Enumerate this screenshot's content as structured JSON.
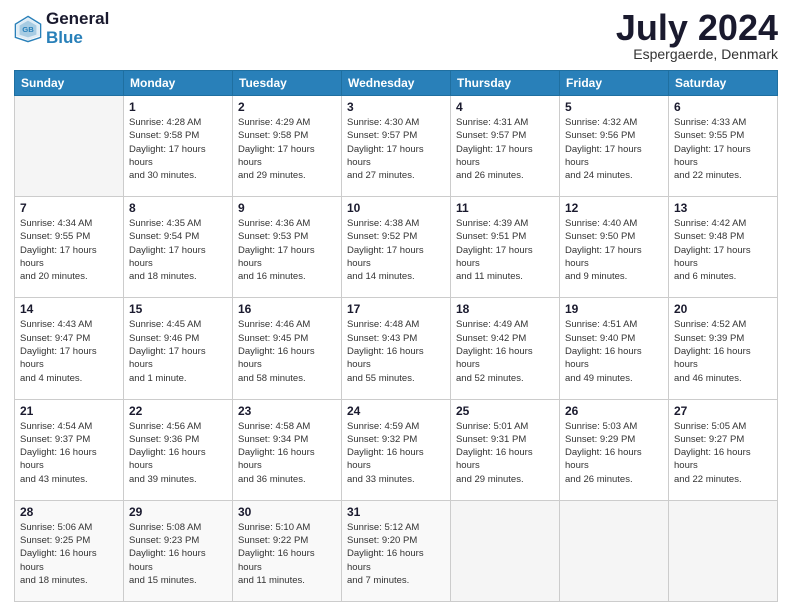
{
  "header": {
    "logo_line1": "General",
    "logo_line2": "Blue",
    "month": "July 2024",
    "location": "Espergaerde, Denmark"
  },
  "days_of_week": [
    "Sunday",
    "Monday",
    "Tuesday",
    "Wednesday",
    "Thursday",
    "Friday",
    "Saturday"
  ],
  "weeks": [
    [
      {
        "day": "",
        "sunrise": "",
        "sunset": "",
        "daylight": ""
      },
      {
        "day": "1",
        "sunrise": "4:28 AM",
        "sunset": "9:58 PM",
        "daylight": "17 hours and 30 minutes."
      },
      {
        "day": "2",
        "sunrise": "4:29 AM",
        "sunset": "9:58 PM",
        "daylight": "17 hours and 29 minutes."
      },
      {
        "day": "3",
        "sunrise": "4:30 AM",
        "sunset": "9:57 PM",
        "daylight": "17 hours and 27 minutes."
      },
      {
        "day": "4",
        "sunrise": "4:31 AM",
        "sunset": "9:57 PM",
        "daylight": "17 hours and 26 minutes."
      },
      {
        "day": "5",
        "sunrise": "4:32 AM",
        "sunset": "9:56 PM",
        "daylight": "17 hours and 24 minutes."
      },
      {
        "day": "6",
        "sunrise": "4:33 AM",
        "sunset": "9:55 PM",
        "daylight": "17 hours and 22 minutes."
      }
    ],
    [
      {
        "day": "7",
        "sunrise": "4:34 AM",
        "sunset": "9:55 PM",
        "daylight": "17 hours and 20 minutes."
      },
      {
        "day": "8",
        "sunrise": "4:35 AM",
        "sunset": "9:54 PM",
        "daylight": "17 hours and 18 minutes."
      },
      {
        "day": "9",
        "sunrise": "4:36 AM",
        "sunset": "9:53 PM",
        "daylight": "17 hours and 16 minutes."
      },
      {
        "day": "10",
        "sunrise": "4:38 AM",
        "sunset": "9:52 PM",
        "daylight": "17 hours and 14 minutes."
      },
      {
        "day": "11",
        "sunrise": "4:39 AM",
        "sunset": "9:51 PM",
        "daylight": "17 hours and 11 minutes."
      },
      {
        "day": "12",
        "sunrise": "4:40 AM",
        "sunset": "9:50 PM",
        "daylight": "17 hours and 9 minutes."
      },
      {
        "day": "13",
        "sunrise": "4:42 AM",
        "sunset": "9:48 PM",
        "daylight": "17 hours and 6 minutes."
      }
    ],
    [
      {
        "day": "14",
        "sunrise": "4:43 AM",
        "sunset": "9:47 PM",
        "daylight": "17 hours and 4 minutes."
      },
      {
        "day": "15",
        "sunrise": "4:45 AM",
        "sunset": "9:46 PM",
        "daylight": "17 hours and 1 minute."
      },
      {
        "day": "16",
        "sunrise": "4:46 AM",
        "sunset": "9:45 PM",
        "daylight": "16 hours and 58 minutes."
      },
      {
        "day": "17",
        "sunrise": "4:48 AM",
        "sunset": "9:43 PM",
        "daylight": "16 hours and 55 minutes."
      },
      {
        "day": "18",
        "sunrise": "4:49 AM",
        "sunset": "9:42 PM",
        "daylight": "16 hours and 52 minutes."
      },
      {
        "day": "19",
        "sunrise": "4:51 AM",
        "sunset": "9:40 PM",
        "daylight": "16 hours and 49 minutes."
      },
      {
        "day": "20",
        "sunrise": "4:52 AM",
        "sunset": "9:39 PM",
        "daylight": "16 hours and 46 minutes."
      }
    ],
    [
      {
        "day": "21",
        "sunrise": "4:54 AM",
        "sunset": "9:37 PM",
        "daylight": "16 hours and 43 minutes."
      },
      {
        "day": "22",
        "sunrise": "4:56 AM",
        "sunset": "9:36 PM",
        "daylight": "16 hours and 39 minutes."
      },
      {
        "day": "23",
        "sunrise": "4:58 AM",
        "sunset": "9:34 PM",
        "daylight": "16 hours and 36 minutes."
      },
      {
        "day": "24",
        "sunrise": "4:59 AM",
        "sunset": "9:32 PM",
        "daylight": "16 hours and 33 minutes."
      },
      {
        "day": "25",
        "sunrise": "5:01 AM",
        "sunset": "9:31 PM",
        "daylight": "16 hours and 29 minutes."
      },
      {
        "day": "26",
        "sunrise": "5:03 AM",
        "sunset": "9:29 PM",
        "daylight": "16 hours and 26 minutes."
      },
      {
        "day": "27",
        "sunrise": "5:05 AM",
        "sunset": "9:27 PM",
        "daylight": "16 hours and 22 minutes."
      }
    ],
    [
      {
        "day": "28",
        "sunrise": "5:06 AM",
        "sunset": "9:25 PM",
        "daylight": "16 hours and 18 minutes."
      },
      {
        "day": "29",
        "sunrise": "5:08 AM",
        "sunset": "9:23 PM",
        "daylight": "16 hours and 15 minutes."
      },
      {
        "day": "30",
        "sunrise": "5:10 AM",
        "sunset": "9:22 PM",
        "daylight": "16 hours and 11 minutes."
      },
      {
        "day": "31",
        "sunrise": "5:12 AM",
        "sunset": "9:20 PM",
        "daylight": "16 hours and 7 minutes."
      },
      {
        "day": "",
        "sunrise": "",
        "sunset": "",
        "daylight": ""
      },
      {
        "day": "",
        "sunrise": "",
        "sunset": "",
        "daylight": ""
      },
      {
        "day": "",
        "sunrise": "",
        "sunset": "",
        "daylight": ""
      }
    ]
  ]
}
